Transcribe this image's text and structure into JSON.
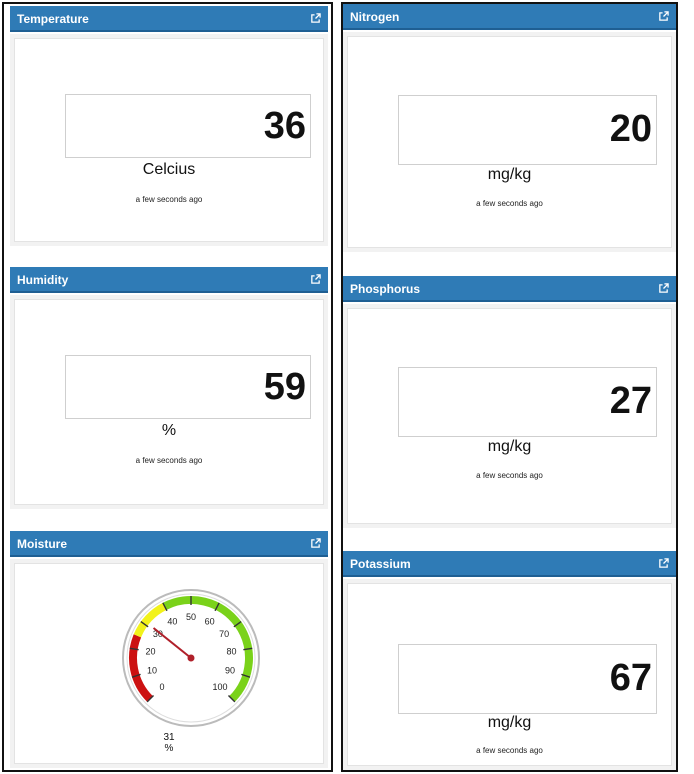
{
  "temperature": {
    "title": "Temperature",
    "value": "36",
    "unit": "Celcius",
    "updated": "a few seconds ago"
  },
  "humidity": {
    "title": "Humidity",
    "value": "59",
    "unit": "%",
    "updated": "a few seconds ago"
  },
  "moisture": {
    "title": "Moisture",
    "value": "31",
    "unit": "%",
    "gauge_min": 0,
    "gauge_max": 100,
    "gauge_ticks": [
      "0",
      "10",
      "20",
      "30",
      "40",
      "50",
      "60",
      "70",
      "80",
      "90",
      "100"
    ]
  },
  "nitrogen": {
    "title": "Nitrogen",
    "value": "20",
    "unit": "mg/kg",
    "updated": "a few seconds ago"
  },
  "phosphorus": {
    "title": "Phosphorus",
    "value": "27",
    "unit": "mg/kg",
    "updated": "a few seconds ago"
  },
  "potassium": {
    "title": "Potassium",
    "value": "67",
    "unit": "mg/kg",
    "updated": "a few seconds ago"
  },
  "colors": {
    "header": "#2f7bb6",
    "gauge_red": "#cc1111",
    "gauge_yellow": "#f2f21a",
    "gauge_green": "#7ad21a",
    "needle": "#b0202a"
  },
  "icons": {
    "widget_action": "external-link-icon"
  }
}
